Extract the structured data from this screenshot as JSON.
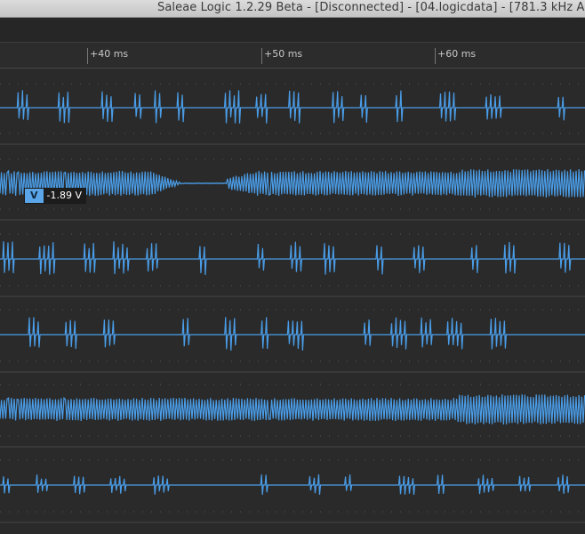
{
  "window": {
    "title": "Saleae Logic 1.2.29 Beta - [Disconnected] - [04.logicdata] - [781.3 kHz A"
  },
  "timeline": {
    "ticks": [
      "+40 ms",
      "+50 ms",
      "+60 ms"
    ]
  },
  "measurement": {
    "badge_label": "V",
    "value": "-1.89 V"
  },
  "channels": [
    {
      "id": "ch-1",
      "style": "bursts"
    },
    {
      "id": "ch-2",
      "style": "dense-with-gap"
    },
    {
      "id": "ch-3",
      "style": "bursts"
    },
    {
      "id": "ch-4",
      "style": "bursts"
    },
    {
      "id": "ch-5",
      "style": "dense"
    },
    {
      "id": "ch-6",
      "style": "sparse-bursts"
    }
  ],
  "colors": {
    "waveform": "#4a9de8",
    "background": "#2a2a2a",
    "separator": "#474747"
  }
}
